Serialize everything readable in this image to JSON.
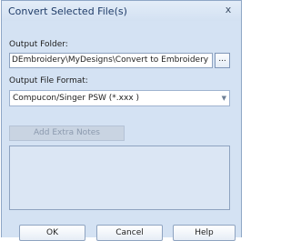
{
  "window": {
    "title": "Convert Selected File(s)",
    "close_glyph": "x"
  },
  "output_folder": {
    "label": "Output Folder:",
    "value": "DEmbroidery\\MyDesigns\\Convert to Embroidery",
    "browse_label": "..."
  },
  "output_format": {
    "label": "Output File Format:",
    "selected": "Compucon/Singer PSW (*.xxx )"
  },
  "notes": {
    "add_button_label": "Add Extra Notes",
    "text": ""
  },
  "buttons": {
    "ok": "OK",
    "cancel": "Cancel",
    "help": "Help"
  },
  "colors": {
    "dialog_background": "#d4e2f3",
    "title_text": "#1f3c68",
    "disabled_button": "#c9d4e2"
  },
  "icons": {
    "close": "close-icon",
    "dropdown": "chevron-down-icon"
  }
}
